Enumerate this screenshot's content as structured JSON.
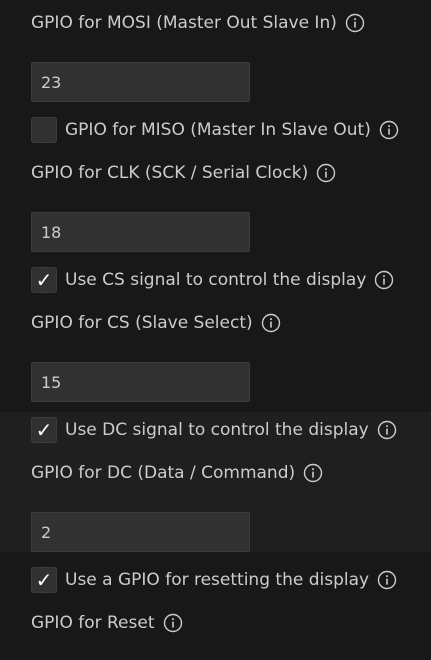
{
  "fields": {
    "mosi": {
      "label": "GPIO for MOSI (Master Out Slave In)",
      "value": "23"
    },
    "clk": {
      "label": "GPIO for CLK (SCK / Serial Clock)",
      "value": "18"
    },
    "cs": {
      "label": "GPIO for CS (Slave Select)",
      "value": "15"
    },
    "dc": {
      "label": "GPIO for DC (Data / Command)",
      "value": "2"
    },
    "reset": {
      "label": "GPIO for Reset"
    }
  },
  "checkboxes": {
    "miso": {
      "label": "GPIO for MISO (Master In Slave Out)",
      "checked": false,
      "mark": ""
    },
    "use_cs": {
      "label": "Use CS signal to control the display",
      "checked": true,
      "mark": "✓"
    },
    "use_dc": {
      "label": "Use DC signal to control the display",
      "checked": true,
      "mark": "✓"
    },
    "use_reset": {
      "label": "Use a GPIO for resetting the display",
      "checked": true,
      "mark": "✓"
    }
  },
  "icons": {
    "info": "info-icon"
  },
  "colors": {
    "background": "#181818",
    "input_background": "#313131",
    "text": "#cccccc"
  }
}
